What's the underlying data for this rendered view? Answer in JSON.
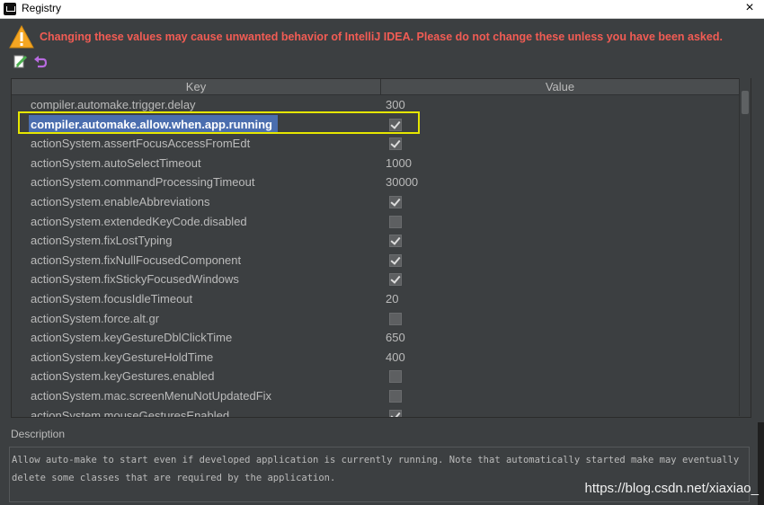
{
  "window": {
    "title": "Registry",
    "close": "×"
  },
  "warning": {
    "text": "Changing these values may cause unwanted behavior of IntelliJ IDEA. Please do not change these unless you have been asked."
  },
  "toolbar": {
    "edit_icon": "edit-icon",
    "revert_icon": "revert-icon"
  },
  "table": {
    "headers": {
      "key": "Key",
      "value": "Value"
    },
    "rows": [
      {
        "key": "compiler.automake.trigger.delay",
        "value": "300",
        "type": "text"
      },
      {
        "key": "compiler.automake.allow.when.app.running",
        "value": "",
        "type": "checkbox",
        "checked": true,
        "selected": true
      },
      {
        "key": "actionSystem.assertFocusAccessFromEdt",
        "value": "",
        "type": "checkbox",
        "checked": true
      },
      {
        "key": "actionSystem.autoSelectTimeout",
        "value": "1000",
        "type": "text"
      },
      {
        "key": "actionSystem.commandProcessingTimeout",
        "value": "30000",
        "type": "text"
      },
      {
        "key": "actionSystem.enableAbbreviations",
        "value": "",
        "type": "checkbox",
        "checked": true
      },
      {
        "key": "actionSystem.extendedKeyCode.disabled",
        "value": "",
        "type": "checkbox",
        "checked": false
      },
      {
        "key": "actionSystem.fixLostTyping",
        "value": "",
        "type": "checkbox",
        "checked": true
      },
      {
        "key": "actionSystem.fixNullFocusedComponent",
        "value": "",
        "type": "checkbox",
        "checked": true
      },
      {
        "key": "actionSystem.fixStickyFocusedWindows",
        "value": "",
        "type": "checkbox",
        "checked": true
      },
      {
        "key": "actionSystem.focusIdleTimeout",
        "value": "20",
        "type": "text"
      },
      {
        "key": "actionSystem.force.alt.gr",
        "value": "",
        "type": "checkbox",
        "checked": false
      },
      {
        "key": "actionSystem.keyGestureDblClickTime",
        "value": "650",
        "type": "text"
      },
      {
        "key": "actionSystem.keyGestureHoldTime",
        "value": "400",
        "type": "text"
      },
      {
        "key": "actionSystem.keyGestures.enabled",
        "value": "",
        "type": "checkbox",
        "checked": false
      },
      {
        "key": "actionSystem.mac.screenMenuNotUpdatedFix",
        "value": "",
        "type": "checkbox",
        "checked": false
      },
      {
        "key": "actionSystem.mouseGesturesEnabled",
        "value": "",
        "type": "checkbox",
        "checked": true
      }
    ]
  },
  "description": {
    "label": "Description",
    "text": "Allow auto-make to start even if developed application is currently running. Note that automatically started make may eventually delete some classes that are required by the application."
  },
  "watermark": "https://blog.csdn.net/xiaxiao_",
  "colors": {
    "warning": "#f25c54",
    "selection": "#4b6eaf",
    "highlight": "#e6e600",
    "background": "#3c3f41"
  }
}
